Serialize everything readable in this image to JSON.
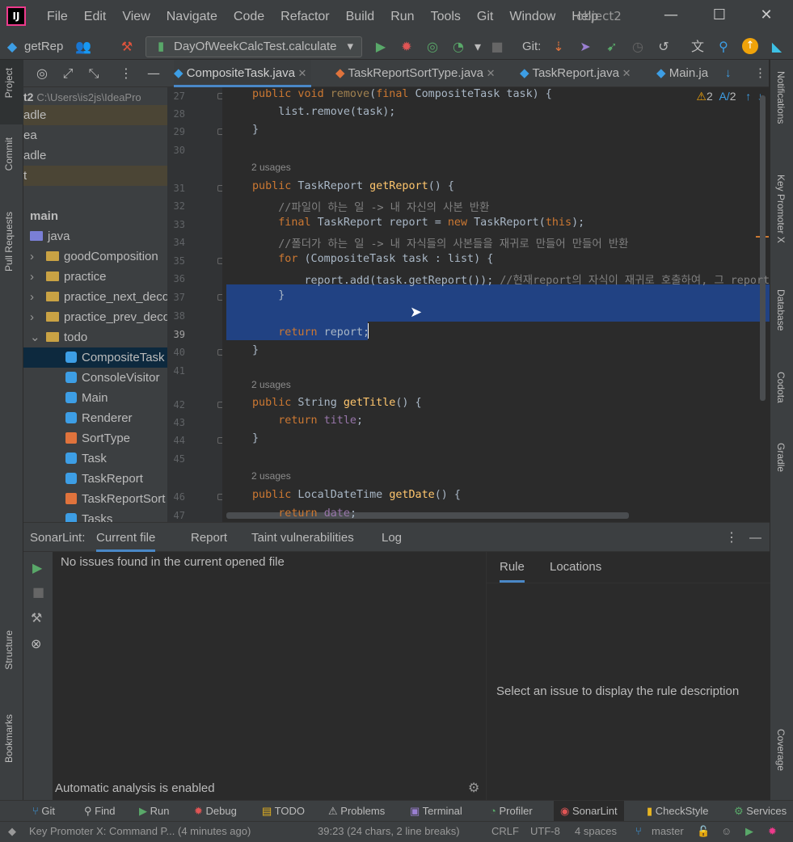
{
  "title_bar": {
    "menu": [
      "File",
      "Edit",
      "View",
      "Navigate",
      "Code",
      "Refactor",
      "Build",
      "Run",
      "Tools",
      "Git",
      "Window",
      "Help"
    ],
    "project_name": "object2"
  },
  "toolbar": {
    "branch_label": "getRep",
    "run_config": "DayOfWeekCalcTest.calculate",
    "git_label": "Git:"
  },
  "left_strip": {
    "project": "Project",
    "commit": "Commit",
    "pull_requests": "Pull Requests",
    "structure": "Structure",
    "bookmarks": "Bookmarks"
  },
  "right_strip": {
    "notifications": "Notifications",
    "key_promoter": "Key Promoter X",
    "database": "Database",
    "codota": "Codota",
    "gradle": "Gradle",
    "coverage": "Coverage"
  },
  "project_panel": {
    "path_label": "t2",
    "path": "C:\\Users\\is2js\\IdeaPro",
    "rows": [
      {
        "text": "adle",
        "kind": "plain",
        "hl": "gold"
      },
      {
        "text": "ea",
        "kind": "plain"
      },
      {
        "text": "adle",
        "kind": "plain"
      },
      {
        "text": "t",
        "kind": "plain",
        "hl": "gold"
      },
      {
        "text": "",
        "kind": "plain"
      },
      {
        "text": "main",
        "kind": "bold"
      },
      {
        "text": "java",
        "kind": "folder"
      },
      {
        "text": "goodComposition",
        "kind": "folder",
        "arrow": "›"
      },
      {
        "text": "practice",
        "kind": "folder",
        "arrow": "›"
      },
      {
        "text": "practice_next_deco",
        "kind": "folder",
        "arrow": "›"
      },
      {
        "text": "practice_prev_deco",
        "kind": "folder",
        "arrow": "›"
      },
      {
        "text": "todo",
        "kind": "folder",
        "arrow": "⌄"
      },
      {
        "text": "CompositeTask",
        "kind": "class",
        "selected": true
      },
      {
        "text": "ConsoleVisitor",
        "kind": "class"
      },
      {
        "text": "Main",
        "kind": "class"
      },
      {
        "text": "Renderer",
        "kind": "class"
      },
      {
        "text": "SortType",
        "kind": "enum"
      },
      {
        "text": "Task",
        "kind": "class"
      },
      {
        "text": "TaskReport",
        "kind": "class"
      },
      {
        "text": "TaskReportSort",
        "kind": "enum"
      },
      {
        "text": "Tasks",
        "kind": "class"
      }
    ]
  },
  "editor_tabs": [
    {
      "label": "CompositeTask.java",
      "active": true
    },
    {
      "label": "TaskReportSortType.java"
    },
    {
      "label": "TaskReport.java"
    },
    {
      "label": "Main.ja"
    }
  ],
  "inspection": {
    "warnings": "2",
    "typos": "2"
  },
  "code_lines": [
    {
      "n": "27",
      "html": "<span class=\"kw\">public void</span> <span style=\"color:#ffc66d;opacity:.55\">remove</span>(<span class=\"kw\">final</span> CompositeTask task) {"
    },
    {
      "n": "28",
      "html": "    list.remove(task);"
    },
    {
      "n": "29",
      "html": "}"
    },
    {
      "n": "30",
      "html": ""
    },
    {
      "n": "",
      "usage": "2 usages"
    },
    {
      "n": "31",
      "html": "<span class=\"kw\">public</span> TaskReport <span class=\"fn\">getReport</span>() {"
    },
    {
      "n": "32",
      "html": "    <span class=\"cm\">//파일이 하는 일 -> 내 자신의 사본 반환</span>"
    },
    {
      "n": "33",
      "html": "    <span class=\"kw\">final</span> TaskReport report = <span class=\"kw\">new</span> TaskReport(<span class=\"kw\">this</span>);"
    },
    {
      "n": "34",
      "html": "    <span class=\"cm\">//폴더가 하는 일 -> 내 자식들의 사본들을 재귀로 만들어 만들어 반환</span>"
    },
    {
      "n": "35",
      "html": "    <span class=\"kw\">for</span> (CompositeTask task : list) {"
    },
    {
      "n": "36",
      "html": "        report.add(task.getReport()); <span class=\"cm\">//현재report의 자식이 재귀로 호출하여, 그 report</span>"
    },
    {
      "n": "37",
      "html": "    }"
    },
    {
      "n": "38",
      "html": ""
    },
    {
      "n": "39",
      "html": "    <span class=\"kw\">return</span> report;"
    },
    {
      "n": "40",
      "html": "}"
    },
    {
      "n": "41",
      "html": ""
    },
    {
      "n": "",
      "usage": "2 usages"
    },
    {
      "n": "42",
      "html": "<span class=\"kw\">public</span> String <span class=\"fn\">getTitle</span>() {"
    },
    {
      "n": "43",
      "html": "    <span class=\"kw\">return</span> <span class=\"fd\">title</span>;"
    },
    {
      "n": "44",
      "html": "}"
    },
    {
      "n": "45",
      "html": ""
    },
    {
      "n": "",
      "usage": "2 usages"
    },
    {
      "n": "46",
      "html": "<span class=\"kw\">public</span> LocalDateTime <span class=\"fn\">getDate</span>() {"
    },
    {
      "n": "47",
      "html": "    <span class=\"kw\">return</span> <span class=\"fd\">date</span>;"
    }
  ],
  "sonarlint": {
    "label": "SonarLint:",
    "tabs": [
      "Current file",
      "Report",
      "Taint vulnerabilities",
      "Log"
    ],
    "message": "No issues found in the current opened file",
    "footer": "Automatic analysis is enabled",
    "rule_tabs": [
      "Rule",
      "Locations"
    ],
    "rule_placeholder": "Select an issue to display the rule description"
  },
  "bottom_tools": [
    "Git",
    "Find",
    "Run",
    "Debug",
    "TODO",
    "Problems",
    "Terminal",
    "Profiler",
    "SonarLint",
    "CheckStyle",
    "Services"
  ],
  "status_bar": {
    "message": "Key Promoter X: Command P... (4 minutes ago)",
    "position": "39:23 (24 chars, 2 line breaks)",
    "line_sep": "CRLF",
    "encoding": "UTF-8",
    "indent": "4 spaces",
    "branch": "master"
  }
}
